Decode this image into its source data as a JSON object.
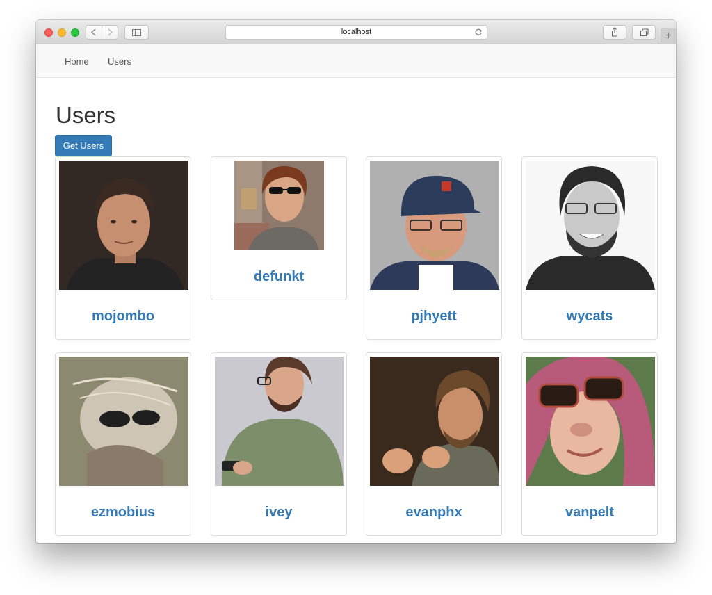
{
  "browser": {
    "url": "localhost"
  },
  "navbar": {
    "items": [
      "Home",
      "Users"
    ]
  },
  "page": {
    "title": "Users",
    "get_users_label": "Get Users"
  },
  "users": [
    {
      "login": "mojombo"
    },
    {
      "login": "defunkt"
    },
    {
      "login": "pjhyett"
    },
    {
      "login": "wycats"
    },
    {
      "login": "ezmobius"
    },
    {
      "login": "ivey"
    },
    {
      "login": "evanphx"
    },
    {
      "login": "vanpelt"
    }
  ],
  "colors": {
    "accent": "#337ab7",
    "navbar_bg": "#f8f8f8",
    "heading": "#333333"
  }
}
